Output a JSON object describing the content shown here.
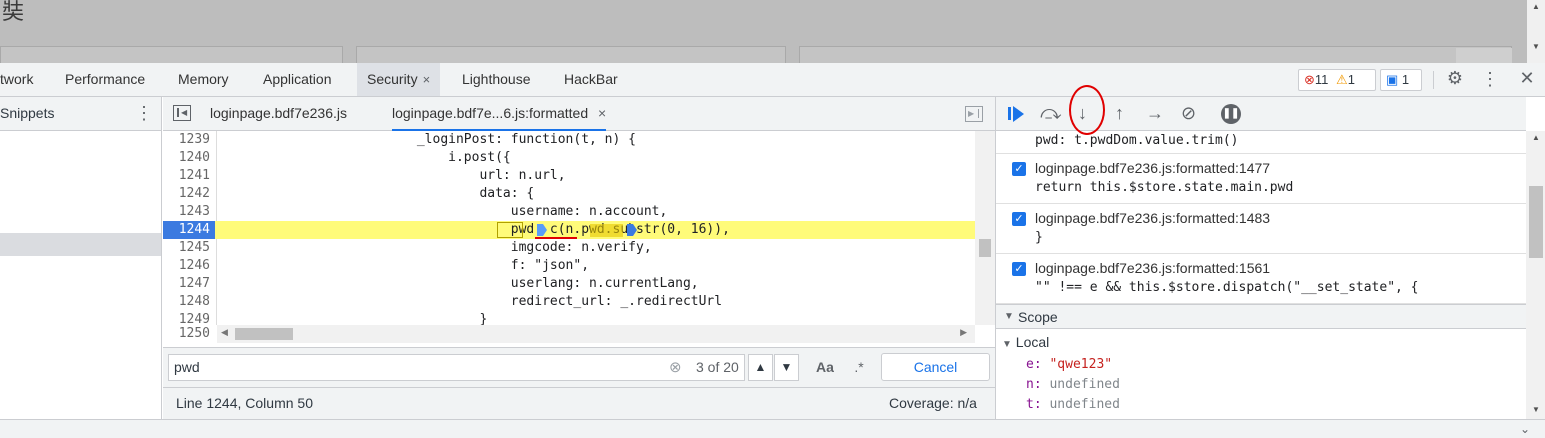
{
  "page": {
    "glyph": "奘"
  },
  "tabs": [
    {
      "label": "twork"
    },
    {
      "label": "Performance"
    },
    {
      "label": "Memory"
    },
    {
      "label": "Application"
    },
    {
      "label": "Security",
      "close": "×"
    },
    {
      "label": "Lighthouse"
    },
    {
      "label": "HackBar"
    }
  ],
  "badges": {
    "errors": "11",
    "warnings": "1",
    "messages": "1"
  },
  "left_nav": {
    "title": "Snippets"
  },
  "editor": {
    "tab1": "loginpage.bdf7e236.js",
    "tab2": "loginpage.bdf7e...6.js:formatted",
    "tab2_close": "×",
    "lines": [
      {
        "no": "1239",
        "code": "                        _loginPost: function(t, n) {"
      },
      {
        "no": "1240",
        "code": "                            i.post({"
      },
      {
        "no": "1241",
        "code": "                                url: n.url,"
      },
      {
        "no": "1242",
        "code": "                                data: {"
      },
      {
        "no": "1243",
        "code": "                                    username: n.account,"
      },
      {
        "no": "1244",
        "code": "                                    pwd: c(n.pwd.substr(0, 16)),"
      },
      {
        "no": "1245",
        "code": "                                    imgcode: n.verify,"
      },
      {
        "no": "1246",
        "code": "                                    f: \"json\","
      },
      {
        "no": "1247",
        "code": "                                    userlang: n.currentLang,"
      },
      {
        "no": "1248",
        "code": "                                    redirect_url: _.redirectUrl"
      },
      {
        "no": "1249",
        "code": "                                }"
      },
      {
        "no": "1250",
        "code": ""
      }
    ],
    "search_value": "pwd",
    "search_count": "3 of 20",
    "aa": "Aa",
    "regex": ".*",
    "cancel": "Cancel",
    "status_left": "Line 1244, Column 50",
    "status_right": "Coverage: n/a"
  },
  "breakpoints": [
    {
      "title": "",
      "snippet": "pwd: t.pwdDom.value.trim()"
    },
    {
      "title": "loginpage.bdf7e236.js:formatted:1477",
      "snippet": "return this.$store.state.main.pwd"
    },
    {
      "title": "loginpage.bdf7e236.js:formatted:1483",
      "snippet": "}"
    },
    {
      "title": "loginpage.bdf7e236.js:formatted:1561",
      "snippet": "\"\" !== e && this.$store.dispatch(\"__set_state\", {"
    }
  ],
  "scope": {
    "title": "Scope",
    "local": "Local",
    "vars": [
      {
        "name": "e:",
        "value": "\"qwe123\""
      },
      {
        "name": "n:",
        "value": "undefined"
      },
      {
        "name": "t:",
        "value": "undefined"
      }
    ]
  },
  "colors": {
    "accent": "#1a73e8",
    "error": "#d93025",
    "warn": "#f29900",
    "highlight": "#fffb7a",
    "annotation": "#e00000"
  }
}
